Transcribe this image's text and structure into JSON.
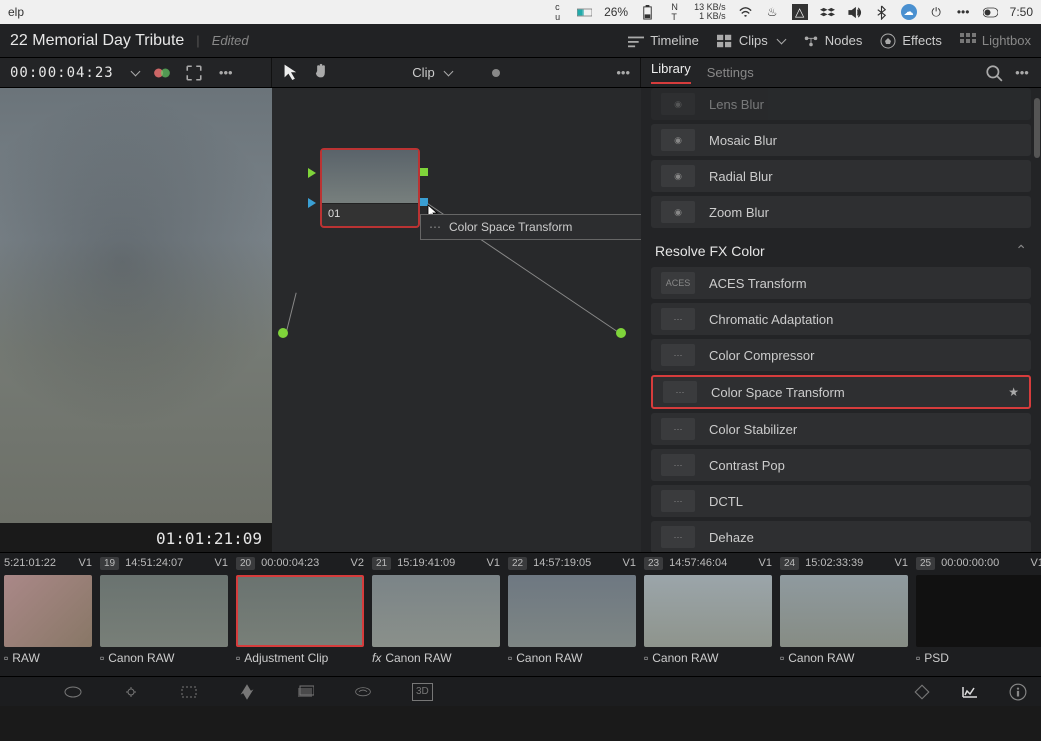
{
  "menubar": {
    "left_label": "elp",
    "battery_pct": "26%",
    "net_down": "13 KB/s",
    "net_up": "1 KB/s",
    "clock": "7:50"
  },
  "pagehdr": {
    "title": "22 Memorial Day Tribute",
    "status": "Edited",
    "buttons": {
      "timeline": "Timeline",
      "clips": "Clips",
      "nodes": "Nodes",
      "effects": "Effects",
      "lightbox": "Lightbox"
    }
  },
  "toolbar": {
    "timecode": "00:00:04:23",
    "clip_label": "Clip",
    "tabs": {
      "library": "Library",
      "settings": "Settings"
    }
  },
  "viewer": {
    "timecode": "01:01:21:09"
  },
  "node": {
    "label": "01",
    "tooltip": "Color Space Transform"
  },
  "fx": {
    "blur_items": [
      "Lens Blur",
      "Mosaic Blur",
      "Radial Blur",
      "Zoom Blur"
    ],
    "category": "Resolve FX Color",
    "color_items": [
      "ACES Transform",
      "Chromatic Adaptation",
      "Color Compressor",
      "Color Space Transform",
      "Color Stabilizer",
      "Contrast Pop",
      "DCTL",
      "Dehaze"
    ],
    "selected": "Color Space Transform",
    "aces_label": "ACES"
  },
  "clips": [
    {
      "num": "",
      "tc": "5:21:01:22",
      "track": "V1",
      "name": "RAW",
      "kind": "first"
    },
    {
      "num": "19",
      "tc": "14:51:24:07",
      "track": "V1",
      "name": "Canon RAW"
    },
    {
      "num": "20",
      "tc": "00:00:04:23",
      "track": "V2",
      "name": "Adjustment Clip",
      "selected": true
    },
    {
      "num": "21",
      "tc": "15:19:41:09",
      "track": "V1",
      "name": "Canon RAW",
      "fx": true
    },
    {
      "num": "22",
      "tc": "14:57:19:05",
      "track": "V1",
      "name": "Canon RAW"
    },
    {
      "num": "23",
      "tc": "14:57:46:04",
      "track": "V1",
      "name": "Canon RAW"
    },
    {
      "num": "24",
      "tc": "15:02:33:39",
      "track": "V1",
      "name": "Canon RAW"
    },
    {
      "num": "25",
      "tc": "00:00:00:00",
      "track": "V1",
      "name": "PSD"
    }
  ],
  "bottom": {
    "threed": "3D"
  }
}
